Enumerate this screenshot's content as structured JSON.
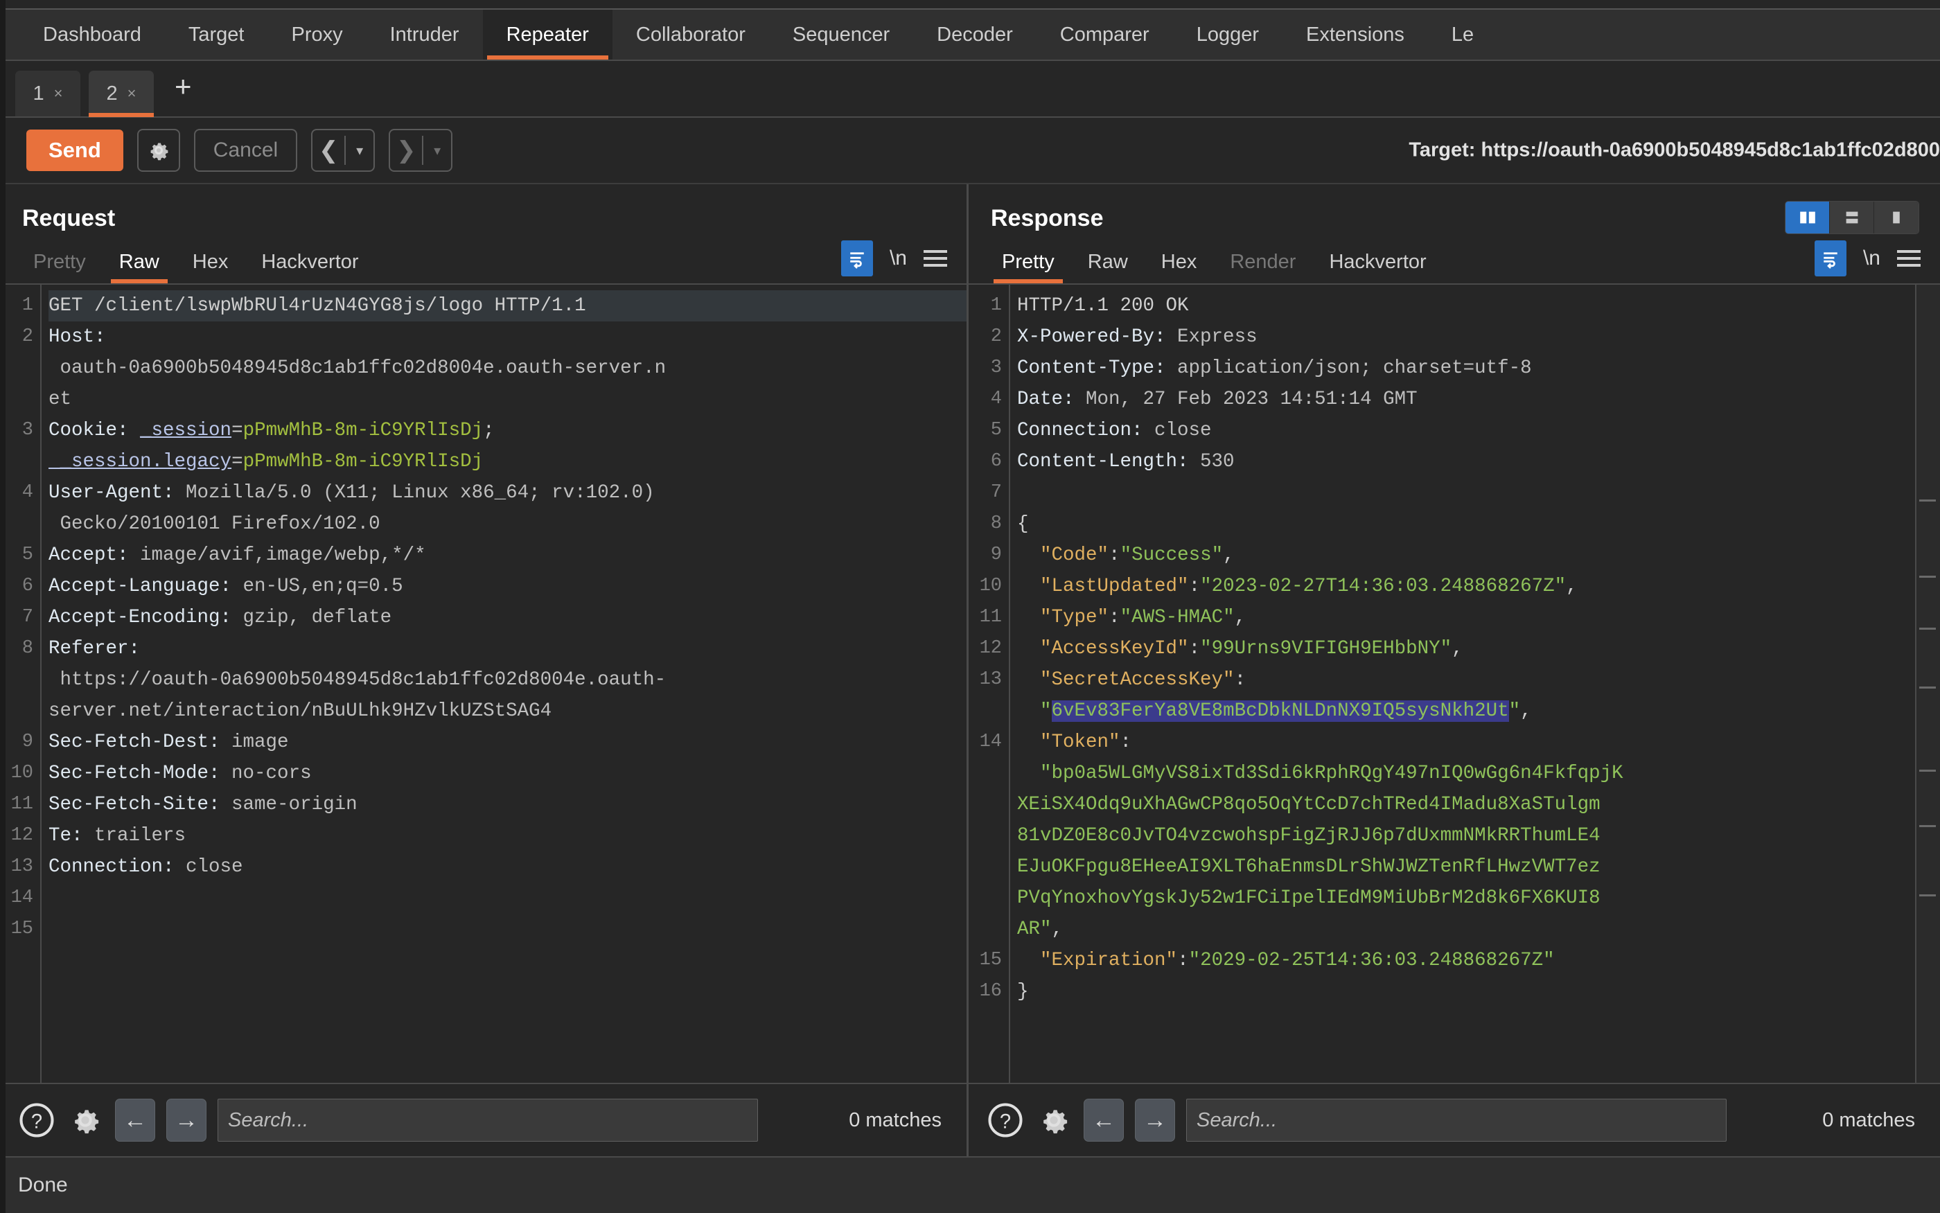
{
  "app": {
    "main_tabs": [
      "Dashboard",
      "Target",
      "Proxy",
      "Intruder",
      "Repeater",
      "Collaborator",
      "Sequencer",
      "Decoder",
      "Comparer",
      "Logger",
      "Extensions",
      "Le"
    ],
    "active_main_tab": "Repeater"
  },
  "repeater": {
    "tabs": [
      {
        "number": "1",
        "close": "×"
      },
      {
        "number": "2",
        "close": "×"
      }
    ],
    "add_tab_label": "+",
    "active_tab": "2"
  },
  "toolbar": {
    "send_label": "Send",
    "settings_icon": "gear-icon",
    "cancel_label": "Cancel",
    "back_caret": "▾",
    "forward_caret": "▾",
    "back_arrow": "‹",
    "forward_arrow": "›",
    "target_label": "Target: https://oauth-0a6900b5048945d8c1ab1ffc02d800"
  },
  "request": {
    "title": "Request",
    "tabs": [
      "Pretty",
      "Raw",
      "Hex",
      "Hackvertor"
    ],
    "active_tab": "Raw",
    "disabled_tabs": [
      "Pretty"
    ],
    "newline_label": "\\n",
    "line_numbers": [
      "1",
      "2",
      "",
      "",
      "3",
      "",
      "4",
      "",
      "5",
      "6",
      "7",
      "8",
      "",
      "",
      "9",
      "10",
      "11",
      "12",
      "13",
      "14",
      "15"
    ],
    "lines": [
      {
        "n": "1",
        "selected": true,
        "parts": [
          {
            "t": "GET /client/lswpWbRUl4rUzN4GYG8js/logo HTTP/1.1",
            "c": "k-plain"
          }
        ]
      },
      {
        "n": "2",
        "parts": [
          {
            "t": "Host:",
            "c": "k-head"
          }
        ]
      },
      {
        "n": "",
        "parts": [
          {
            "t": " oauth-0a6900b5048945d8c1ab1ffc02d8004e.oauth-server.n",
            "c": "k-val"
          }
        ]
      },
      {
        "n": "",
        "parts": [
          {
            "t": "et",
            "c": "k-val"
          }
        ]
      },
      {
        "n": "3",
        "parts": [
          {
            "t": "Cookie: ",
            "c": "k-head"
          },
          {
            "t": "_session",
            "c": "k-cookiename"
          },
          {
            "t": "=",
            "c": "k-punct"
          },
          {
            "t": "pPmwMhB-8m-iC9YRlIsDj",
            "c": "k-cookieval"
          },
          {
            "t": ";",
            "c": "k-punct"
          }
        ]
      },
      {
        "n": "",
        "parts": [
          {
            "t": " _session.legacy",
            "c": "k-cookiename"
          },
          {
            "t": "=",
            "c": "k-punct"
          },
          {
            "t": "pPmwMhB-8m-iC9YRlIsDj",
            "c": "k-cookieval"
          }
        ]
      },
      {
        "n": "4",
        "parts": [
          {
            "t": "User-Agent:",
            "c": "k-head"
          },
          {
            "t": " Mozilla/5.0 (X11; Linux x86_64; rv:102.0)",
            "c": "k-val"
          }
        ]
      },
      {
        "n": "",
        "parts": [
          {
            "t": " Gecko/20100101 Firefox/102.0",
            "c": "k-val"
          }
        ]
      },
      {
        "n": "5",
        "parts": [
          {
            "t": "Accept:",
            "c": "k-head"
          },
          {
            "t": " image/avif,image/webp,*/*",
            "c": "k-val"
          }
        ]
      },
      {
        "n": "6",
        "parts": [
          {
            "t": "Accept-Language:",
            "c": "k-head"
          },
          {
            "t": " en-US,en;q=0.5",
            "c": "k-val"
          }
        ]
      },
      {
        "n": "7",
        "parts": [
          {
            "t": "Accept-Encoding:",
            "c": "k-head"
          },
          {
            "t": " gzip, deflate",
            "c": "k-val"
          }
        ]
      },
      {
        "n": "8",
        "parts": [
          {
            "t": "Referer:",
            "c": "k-head"
          }
        ]
      },
      {
        "n": "",
        "parts": [
          {
            "t": " https://oauth-0a6900b5048945d8c1ab1ffc02d8004e.oauth-",
            "c": "k-val"
          }
        ]
      },
      {
        "n": "",
        "parts": [
          {
            "t": "server.net/interaction/nBuULhk9HZvlkUZStSAG4",
            "c": "k-val"
          }
        ]
      },
      {
        "n": "9",
        "parts": [
          {
            "t": "Sec-Fetch-Dest:",
            "c": "k-head"
          },
          {
            "t": " image",
            "c": "k-val"
          }
        ]
      },
      {
        "n": "10",
        "parts": [
          {
            "t": "Sec-Fetch-Mode:",
            "c": "k-head"
          },
          {
            "t": " no-cors",
            "c": "k-val"
          }
        ]
      },
      {
        "n": "11",
        "parts": [
          {
            "t": "Sec-Fetch-Site:",
            "c": "k-head"
          },
          {
            "t": " same-origin",
            "c": "k-val"
          }
        ]
      },
      {
        "n": "12",
        "parts": [
          {
            "t": "Te:",
            "c": "k-head"
          },
          {
            "t": " trailers",
            "c": "k-val"
          }
        ]
      },
      {
        "n": "13",
        "parts": [
          {
            "t": "Connection:",
            "c": "k-head"
          },
          {
            "t": " close",
            "c": "k-val"
          }
        ]
      },
      {
        "n": "14",
        "parts": [
          {
            "t": "",
            "c": "k-val"
          }
        ]
      },
      {
        "n": "15",
        "parts": [
          {
            "t": "",
            "c": "k-val"
          }
        ]
      }
    ],
    "search_placeholder": "Search...",
    "matches_label": "0 matches",
    "help_icon": "question-circle-icon",
    "settings_icon": "gear-icon",
    "prev_icon": "arrow-left-icon",
    "next_icon": "arrow-right-icon"
  },
  "response": {
    "title": "Response",
    "tabs": [
      "Pretty",
      "Raw",
      "Hex",
      "Render",
      "Hackvertor"
    ],
    "active_tab": "Pretty",
    "disabled_tabs": [
      "Render"
    ],
    "newline_label": "\\n",
    "view_modes": [
      "split-vertical",
      "split-horizontal",
      "single-pane"
    ],
    "active_view_mode": "split-vertical",
    "lines": [
      {
        "n": "1",
        "parts": [
          {
            "t": "HTTP/1.1 200 OK",
            "c": "k-plain"
          }
        ]
      },
      {
        "n": "2",
        "parts": [
          {
            "t": "X-Powered-By:",
            "c": "k-head"
          },
          {
            "t": " Express",
            "c": "k-val"
          }
        ]
      },
      {
        "n": "3",
        "parts": [
          {
            "t": "Content-Type:",
            "c": "k-head"
          },
          {
            "t": " application/json; charset=utf-8",
            "c": "k-val"
          }
        ]
      },
      {
        "n": "4",
        "parts": [
          {
            "t": "Date:",
            "c": "k-head"
          },
          {
            "t": " Mon, 27 Feb 2023 14:51:14 GMT",
            "c": "k-val"
          }
        ]
      },
      {
        "n": "5",
        "parts": [
          {
            "t": "Connection:",
            "c": "k-head"
          },
          {
            "t": " close",
            "c": "k-val"
          }
        ]
      },
      {
        "n": "6",
        "parts": [
          {
            "t": "Content-Length:",
            "c": "k-head"
          },
          {
            "t": " 530",
            "c": "k-val"
          }
        ]
      },
      {
        "n": "7",
        "parts": [
          {
            "t": "",
            "c": "k-val"
          }
        ]
      },
      {
        "n": "8",
        "parts": [
          {
            "t": "{",
            "c": "k-punct"
          }
        ]
      },
      {
        "n": "9",
        "parts": [
          {
            "t": "  \"Code\"",
            "c": "k-jkey"
          },
          {
            "t": ":",
            "c": "k-punct"
          },
          {
            "t": "\"Success\"",
            "c": "k-jstr"
          },
          {
            "t": ",",
            "c": "k-punct"
          }
        ]
      },
      {
        "n": "10",
        "parts": [
          {
            "t": "  \"LastUpdated\"",
            "c": "k-jkey"
          },
          {
            "t": ":",
            "c": "k-punct"
          },
          {
            "t": "\"2023-02-27T14:36:03.248868267Z\"",
            "c": "k-jstr"
          },
          {
            "t": ",",
            "c": "k-punct"
          }
        ]
      },
      {
        "n": "11",
        "parts": [
          {
            "t": "  \"Type\"",
            "c": "k-jkey"
          },
          {
            "t": ":",
            "c": "k-punct"
          },
          {
            "t": "\"AWS-HMAC\"",
            "c": "k-jstr"
          },
          {
            "t": ",",
            "c": "k-punct"
          }
        ]
      },
      {
        "n": "12",
        "parts": [
          {
            "t": "  \"AccessKeyId\"",
            "c": "k-jkey"
          },
          {
            "t": ":",
            "c": "k-punct"
          },
          {
            "t": "\"99Urns9VIFIGH9EHbbNY\"",
            "c": "k-jstr"
          },
          {
            "t": ",",
            "c": "k-punct"
          }
        ]
      },
      {
        "n": "13",
        "parts": [
          {
            "t": "  \"SecretAccessKey\"",
            "c": "k-jkey"
          },
          {
            "t": ":",
            "c": "k-punct"
          }
        ]
      },
      {
        "n": "",
        "parts": [
          {
            "t": "  \"",
            "c": "k-jstr"
          },
          {
            "t": "6vEv83FerYa8VE8mBcDbkNLDnNX9IQ5sysNkh2Ut",
            "c": "k-jstr sel-hl"
          },
          {
            "t": "\"",
            "c": "k-jstr"
          },
          {
            "t": ",",
            "c": "k-punct"
          }
        ]
      },
      {
        "n": "14",
        "parts": [
          {
            "t": "  \"Token\"",
            "c": "k-jkey"
          },
          {
            "t": ":",
            "c": "k-punct"
          }
        ]
      },
      {
        "n": "",
        "parts": [
          {
            "t": "  \"bp0a5WLGMyVS8ixTd3Sdi6kRphRQgY497nIQ0wGg6n4FkfqpjK",
            "c": "k-jstr"
          }
        ]
      },
      {
        "n": "",
        "parts": [
          {
            "t": "XEiSX4Odq9uXhAGwCP8qo5OqYtCcD7chTRed4IMadu8XaSTulgm",
            "c": "k-jstr"
          }
        ]
      },
      {
        "n": "",
        "parts": [
          {
            "t": "81vDZ0E8c0JvTO4vzcwohspFigZjRJJ6p7dUxmmNMkRRThumLE4",
            "c": "k-jstr"
          }
        ]
      },
      {
        "n": "",
        "parts": [
          {
            "t": "EJuOKFpgu8EHeeAI9XLT6haEnmsDLrShWJWZTenRfLHwzVWT7ez",
            "c": "k-jstr"
          }
        ]
      },
      {
        "n": "",
        "parts": [
          {
            "t": "PVqYnoxhovYgskJy52w1FCiIpelIEdM9MiUbBrM2d8k6FX6KUI8",
            "c": "k-jstr"
          }
        ]
      },
      {
        "n": "",
        "parts": [
          {
            "t": "AR\"",
            "c": "k-jstr"
          },
          {
            "t": ",",
            "c": "k-punct"
          }
        ]
      },
      {
        "n": "15",
        "parts": [
          {
            "t": "  \"Expiration\"",
            "c": "k-jkey"
          },
          {
            "t": ":",
            "c": "k-punct"
          },
          {
            "t": "\"2029-02-25T14:36:03.248868267Z\"",
            "c": "k-jstr"
          }
        ]
      },
      {
        "n": "16",
        "parts": [
          {
            "t": "}",
            "c": "k-punct"
          }
        ]
      }
    ],
    "search_placeholder": "Search...",
    "matches_label": "0 matches",
    "help_icon": "question-circle-icon",
    "settings_icon": "gear-icon",
    "prev_icon": "arrow-left-icon",
    "next_icon": "arrow-right-icon"
  },
  "status": {
    "text": "Done"
  },
  "colors": {
    "accent": "#e8713c",
    "selection": "#3b3b8c",
    "toggle_active": "#2a72c4",
    "json_key": "#e0b060",
    "json_string": "#8fc25a",
    "cookie_value": "#a3bf3f",
    "background": "#262626"
  }
}
